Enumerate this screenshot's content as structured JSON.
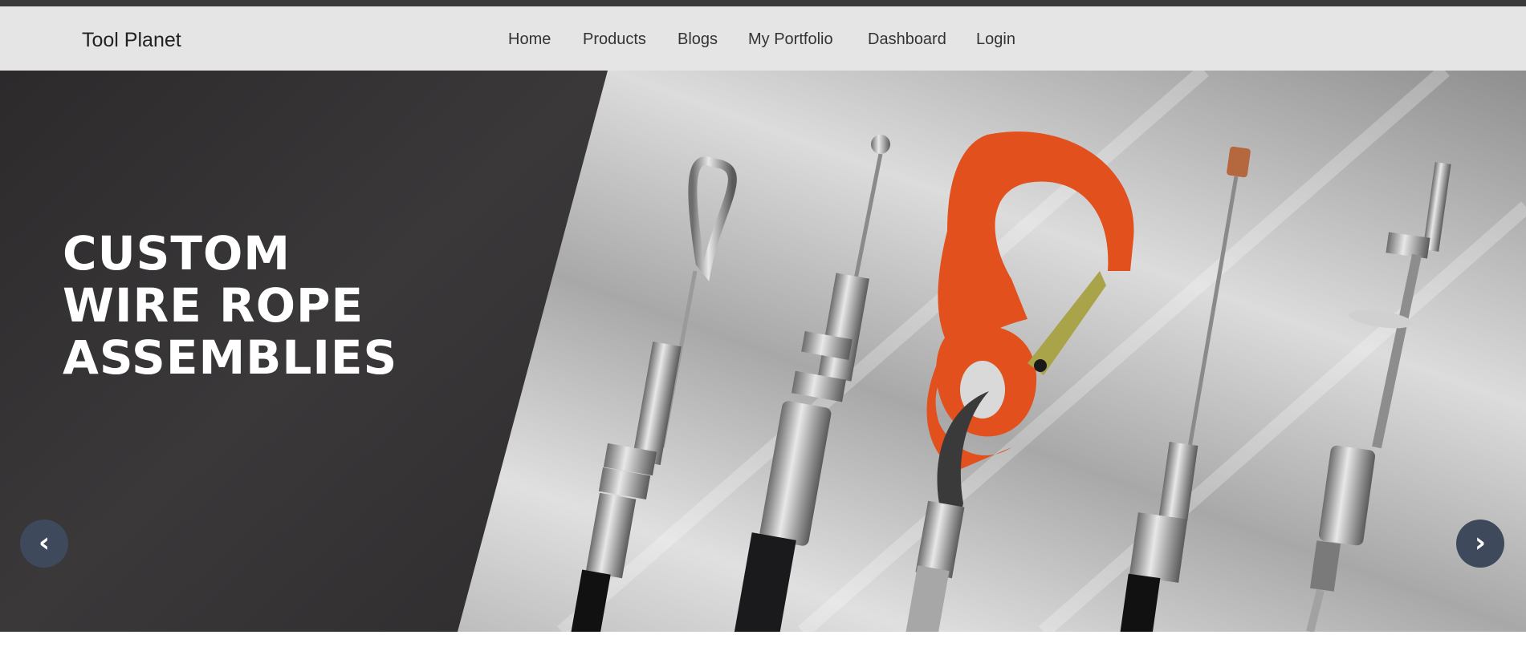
{
  "navbar": {
    "brand": "Tool Planet",
    "links": [
      {
        "label": "Home"
      },
      {
        "label": "Products"
      },
      {
        "label": "Blogs"
      },
      {
        "label": "My Portfolio"
      },
      {
        "label": "Dashboard"
      },
      {
        "label": "Login"
      }
    ]
  },
  "hero": {
    "headline_lines": [
      "CUSTOM",
      "WIRE ROPE",
      "ASSEMBLIES"
    ],
    "prev_icon": "chevron-left-icon",
    "next_icon": "chevron-right-icon",
    "prev_glyph": "‹",
    "next_glyph": "›"
  },
  "colors": {
    "topbar": "#3a3a3a",
    "navbar_bg": "#e5e5e5",
    "hero_dark": "#333132",
    "hook_orange": "#e2501d",
    "carousel_button": "#3e4a5c"
  }
}
